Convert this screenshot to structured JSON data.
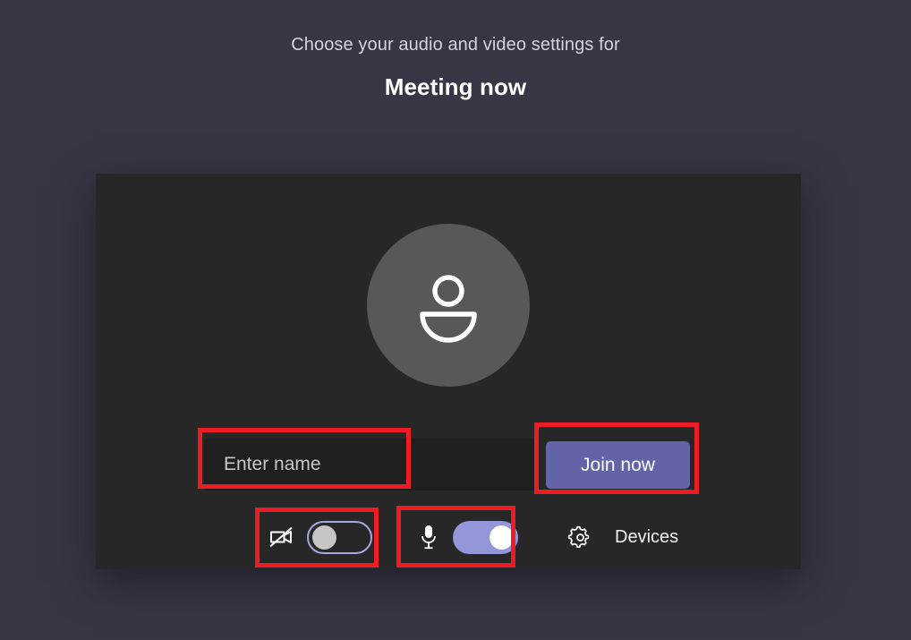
{
  "header": {
    "subtitle": "Choose your audio and video settings for",
    "title": "Meeting now"
  },
  "preview": {
    "avatar_icon": "person-avatar-icon",
    "avatar_color": "#585858",
    "panel_color": "#272727"
  },
  "form": {
    "name_input": {
      "value": "",
      "placeholder": "Enter name"
    },
    "join_button": {
      "label": "Join now",
      "color": "#6264a7"
    }
  },
  "controls": {
    "camera": {
      "icon": "camera-off-icon",
      "state": "off",
      "toggle_border_color": "#a6a8e0",
      "knob_color": "#c6c6c6"
    },
    "microphone": {
      "icon": "microphone-icon",
      "state": "on",
      "toggle_color": "#9396d8",
      "knob_color": "#ffffff"
    },
    "devices": {
      "icon": "gear-icon",
      "label": "Devices"
    }
  },
  "annotations": {
    "color": "#ed1c24",
    "boxes": [
      {
        "target": "name-input"
      },
      {
        "target": "join-button"
      },
      {
        "target": "camera-toggle"
      },
      {
        "target": "microphone-toggle"
      }
    ]
  },
  "theme": {
    "background": "#383644"
  }
}
